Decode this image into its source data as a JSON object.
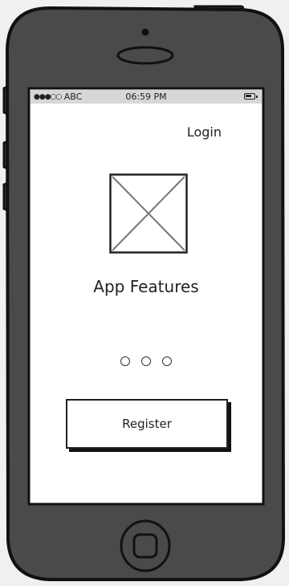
{
  "status_bar": {
    "carrier": "ABC",
    "time": "06:59 PM",
    "signal_icon": "signal-dots-icon",
    "battery_icon": "battery-icon"
  },
  "header": {
    "login_label": "Login"
  },
  "hero": {
    "image_icon": "image-placeholder-icon",
    "title": "App Features"
  },
  "pager": {
    "page_count": 3,
    "icon": "pager-dot-icon"
  },
  "actions": {
    "register_label": "Register"
  },
  "colors": {
    "device_body": "#4a4a4a",
    "device_outline": "#111111",
    "status_bar_bg": "#d7d7d7",
    "screen_bg": "#ffffff"
  }
}
